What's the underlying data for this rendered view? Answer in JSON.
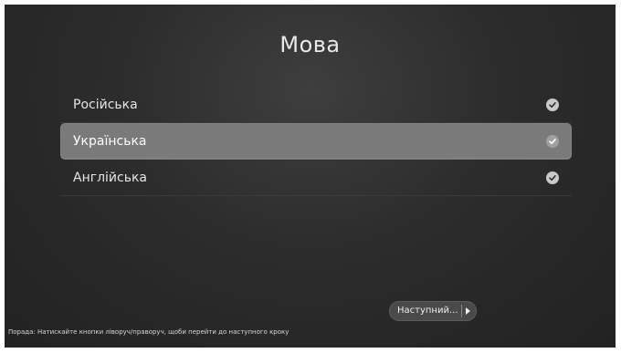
{
  "screen": {
    "title": "Мова"
  },
  "languages": [
    {
      "label": "Російська",
      "checked": true,
      "focused": false
    },
    {
      "label": "Українська",
      "checked": true,
      "focused": true
    },
    {
      "label": "Англійська",
      "checked": true,
      "focused": false
    }
  ],
  "next_button": {
    "label": "Наступний...",
    "icon": "play-arrow-icon"
  },
  "hint": "Порада: Натискайте кнопки ліворуч/праворуч, щоби перейти до наступного кроку",
  "colors": {
    "background": "#2c2c2c",
    "focus_highlight": "#7a7a7a",
    "text": "#e6e6e6"
  }
}
